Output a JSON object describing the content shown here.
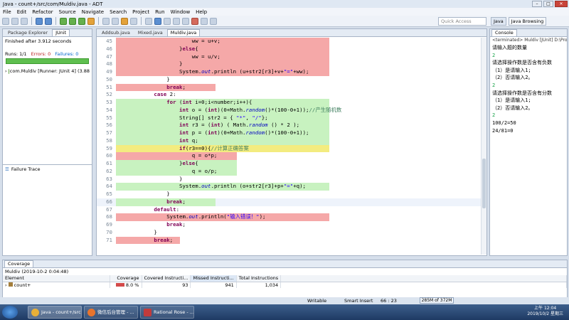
{
  "window": {
    "title": "Java - count+/src/com/Muldiv.java - ADT"
  },
  "menu": [
    "File",
    "Edit",
    "Refactor",
    "Source",
    "Navigate",
    "Search",
    "Project",
    "Run",
    "Window",
    "Help"
  ],
  "toolbar": {
    "quick_access": "Quick Access",
    "persp_java": "Java",
    "persp_browsing": "Java Browsing"
  },
  "left": {
    "tabs": [
      "Package Explorer",
      "JUnit"
    ],
    "finished": "Finished after 3.912 seconds",
    "runs": "Runs:  1/1",
    "errors": "Errors:  0",
    "failures": "Failures:  0",
    "tree_item": "com.Muldiv [Runner: JUnit 4] (3.88",
    "failure_trace": "Failure Trace"
  },
  "editor": {
    "tabs": [
      "Addsub.java",
      "Mixed.java",
      "Muldiv.java"
    ],
    "lines": [
      {
        "n": "45",
        "bg": "#f5a8a8",
        "html": "                        ww = u+v;"
      },
      {
        "n": "46",
        "bg": "#f5a8a8",
        "html": "                    }<span class='kw'>else</span>{"
      },
      {
        "n": "47",
        "bg": "#f5a8a8",
        "html": "                        ww = u/v;"
      },
      {
        "n": "48",
        "bg": "#f5a8a8",
        "html": "                    }"
      },
      {
        "n": "49",
        "bg": "#f5a8a8",
        "html": "                    System.<span class='it'>out</span>.println (u+str2[r3]+v+<span class='st'>\"=\"</span>+ww);"
      },
      {
        "n": "50",
        "bg": "",
        "html": "                }"
      },
      {
        "n": "51",
        "bg": "#f5a8a8",
        "html": "                <span class='kw'>break</span>;"
      },
      {
        "n": "52",
        "bg": "",
        "html": "            <span class='kw'>case</span> 2:"
      },
      {
        "n": "53",
        "bg": "#c8f2c0",
        "html": "                <span class='kw'>for</span> (<span class='kw'>int</span> i=0;i&lt;number;i++){"
      },
      {
        "n": "54",
        "bg": "#c8f2c0",
        "html": "                    <span class='kw'>int</span> o = (<span class='kw'>int</span>)(0+Math.<span class='it'>random</span>()*(100-0+1));<span class='cm'>//产生随机数</span>"
      },
      {
        "n": "55",
        "bg": "#c8f2c0",
        "html": "                    String[] str2 = { <span class='st'>\"*\"</span>, <span class='st'>\"/\"</span>};"
      },
      {
        "n": "56",
        "bg": "#c8f2c0",
        "html": "                    <span class='kw'>int</span> r3 = (<span class='kw'>int</span>) ( Math.<span class='it'>random</span> () * 2 );"
      },
      {
        "n": "57",
        "bg": "#c8f2c0",
        "html": "                    <span class='kw'>int</span> p = (<span class='kw'>int</span>)(0+Math.<span class='it'>random</span>()*(100-0+1));"
      },
      {
        "n": "58",
        "bg": "#c8f2c0",
        "html": "                    <span class='kw'>int</span> q;"
      },
      {
        "n": "59",
        "bg": "#f3ec80",
        "html": "                    <span class='kw'>if</span>(r3==0){<span class='cm'>//计算正确答案</span>"
      },
      {
        "n": "60",
        "bg": "#f5a8a8",
        "html": "                        q = o*p;"
      },
      {
        "n": "61",
        "bg": "#c8f2c0",
        "html": "                    }<span class='kw'>else</span>{"
      },
      {
        "n": "62",
        "bg": "#c8f2c0",
        "html": "                        q = o/p;"
      },
      {
        "n": "63",
        "bg": "",
        "html": "                    }"
      },
      {
        "n": "64",
        "bg": "#c8f2c0",
        "html": "                    System.<span class='it'>out</span>.println (o+str2[r3]+p+<span class='st'>\"=\"</span>+q);"
      },
      {
        "n": "65",
        "bg": "",
        "html": "                }"
      },
      {
        "n": "66",
        "bg": "#c8f2c0",
        "html": "                <span class='kw'>break</span>;"
      },
      {
        "n": "67",
        "bg": "",
        "html": "            <span class='kw'>default</span>:"
      },
      {
        "n": "68",
        "bg": "#f5a8a8",
        "html": "                System.<span class='it'>out</span>.println(<span class='st'>\"输入错误！\"</span>);"
      },
      {
        "n": "69",
        "bg": "",
        "html": "                <span class='kw'>break</span>;"
      },
      {
        "n": "70",
        "bg": "",
        "html": "            }"
      },
      {
        "n": "71",
        "bg": "#f5a8a8",
        "html": "            <span class='kw'>break</span>;"
      }
    ]
  },
  "console": {
    "tab": "Console",
    "header": "<terminated> Muldiv [JUnit] D:\\Pro",
    "lines": [
      {
        "t": "请输入题的数量",
        "c": ""
      },
      {
        "t": "2",
        "c": "in"
      },
      {
        "t": "请选择操作数是否含有负数",
        "c": ""
      },
      {
        "t": "（1）是请输入1;",
        "c": ""
      },
      {
        "t": "（2）否请输入2。",
        "c": ""
      },
      {
        "t": "2",
        "c": "in"
      },
      {
        "t": "请选择操作数是否含有分数",
        "c": ""
      },
      {
        "t": "（1）是请输入1;",
        "c": ""
      },
      {
        "t": "（2）否请输入2。",
        "c": ""
      },
      {
        "t": "2",
        "c": "in"
      },
      {
        "t": "100/2=50",
        "c": ""
      },
      {
        "t": "24/81=0",
        "c": ""
      }
    ]
  },
  "coverage": {
    "tab": "Coverage",
    "session": "Muldiv (2019-10-2 0:04:48)",
    "columns": [
      "Element",
      "Coverage",
      "Covered Instructi...",
      "Missed Instructi...",
      "Total Instructions"
    ],
    "row": {
      "element": "count+",
      "coverage": "8.0 %",
      "covered": "93",
      "missed": "941",
      "total": "1,034"
    }
  },
  "status": {
    "writable": "Writable",
    "insert": "Smart Insert",
    "pos": "66 : 23",
    "memory": "285M of 372M"
  },
  "taskbar": {
    "items": [
      "Java - count+/src...",
      "微信后台管理 - ...",
      "Rational Rose - ..."
    ],
    "time": "上午 12:04",
    "date": "2019/10/2 星期三"
  }
}
